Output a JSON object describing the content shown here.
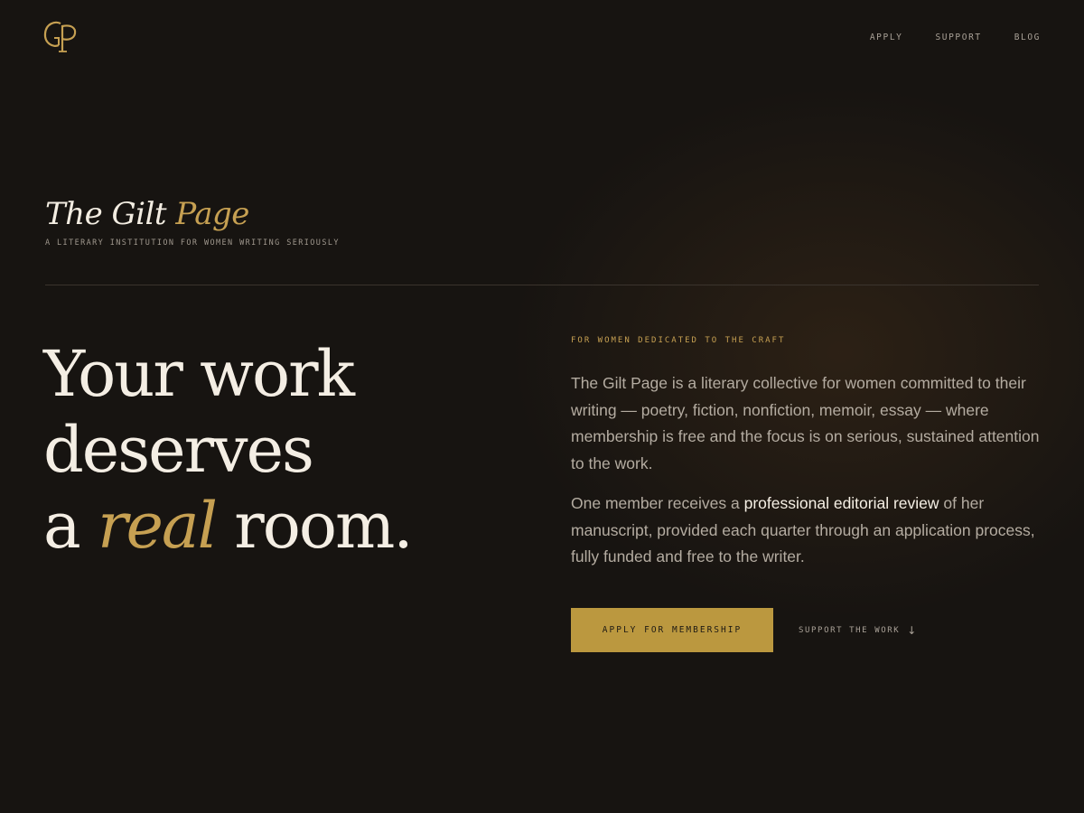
{
  "logo": {
    "text": "GP",
    "color": "#c6a052"
  },
  "nav": {
    "items": [
      {
        "label": "APPLY"
      },
      {
        "label": "SUPPORT"
      },
      {
        "label": "BLOG"
      }
    ]
  },
  "brand": {
    "title_main": "The Gilt ",
    "title_accent": "Page",
    "tagline": "A LITERARY INSTITUTION FOR WOMEN WRITING SERIOUSLY"
  },
  "hero": {
    "line1": "Your work",
    "line2": "deserves",
    "line3_prefix": "a ",
    "line3_accent": "real",
    "line3_suffix": " room."
  },
  "intro": {
    "eyebrow": "FOR WOMEN DEDICATED TO THE CRAFT",
    "paragraph1": "The Gilt Page is a literary collective for women committed to their writing — poetry, fiction, nonfiction, memoir, essay — where membership is free and the focus is on serious, sustained attention to the work.",
    "paragraph2_prefix": "One member receives a ",
    "paragraph2_highlight": "professional editorial review",
    "paragraph2_suffix": " of her manuscript, provided each quarter through an application process, fully funded and free to the writer."
  },
  "actions": {
    "primary_label": "APPLY FOR MEMBERSHIP",
    "secondary_label": "SUPPORT THE WORK",
    "secondary_icon": "arrow-down-icon"
  },
  "colors": {
    "background": "#171411",
    "accent_gold": "#c6a052",
    "button_gold": "#bb983f",
    "text_primary": "#f3ede2",
    "text_muted": "#b4aca1"
  }
}
